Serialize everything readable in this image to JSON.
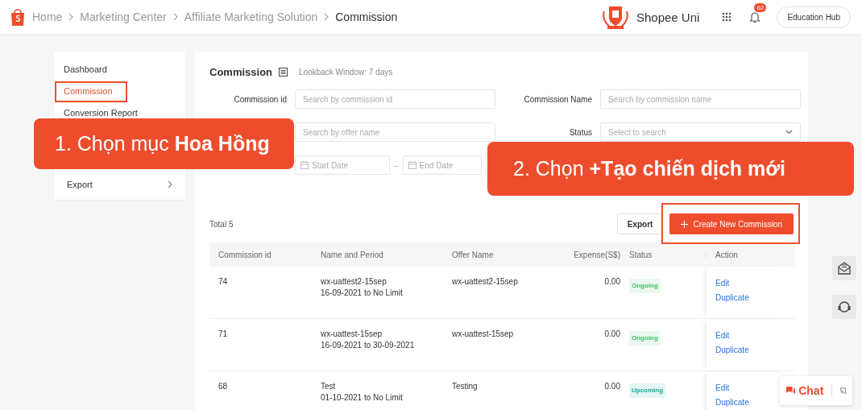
{
  "breadcrumb": [
    {
      "label": "Home",
      "current": false
    },
    {
      "label": "Marketing Center",
      "current": false
    },
    {
      "label": "Affiliate Marketing Solution",
      "current": false
    },
    {
      "label": "Commission",
      "current": true
    }
  ],
  "header": {
    "brand": "Shopee Uni",
    "notification_count": "62",
    "button": "Education Hub"
  },
  "sidebar": {
    "items": [
      {
        "label": "Dashboard",
        "selected": false
      },
      {
        "label": "Commission",
        "selected": true
      },
      {
        "label": "Conversion Report",
        "selected": false
      }
    ],
    "export": "Export"
  },
  "page": {
    "title": "Commission",
    "lookback": "Lookback Window: 7 days"
  },
  "filters": [
    {
      "kind": "text",
      "label": "Commission id",
      "placeholder": "Search by commission id"
    },
    {
      "kind": "text",
      "label": "Commission Name",
      "placeholder": "Search by commission name"
    },
    {
      "kind": "text",
      "placeholder": "Search by offer name"
    },
    {
      "kind": "select",
      "label": "Status",
      "placeholder": "Select to search"
    },
    {
      "kind": "daterange",
      "start_placeholder": "Start Date",
      "separator": "–",
      "end_placeholder": "End Date"
    }
  ],
  "total": "Total 5",
  "buttons": {
    "export": "Export",
    "create": "Create New Commission"
  },
  "table": {
    "columns": [
      "Commission id",
      "Name and Period",
      "Offer Name",
      "Expense(S$)",
      "Status",
      "Action"
    ],
    "rows": [
      {
        "id": "74",
        "name": "wx-uattest2-15sep",
        "period": "16-09-2021 to No Limit",
        "offer": "wx-uattest2-15sep",
        "expense": "0.00",
        "status": {
          "label": "Ongoing",
          "color": "#46c16b"
        },
        "actions": [
          "Edit",
          "Duplicate"
        ]
      },
      {
        "id": "71",
        "name": "wx-uattest-15sep",
        "period": "16-09-2021 to 30-09-2021",
        "offer": "wx-uattest-15sep",
        "expense": "0.00",
        "status": {
          "label": "Ongoing",
          "color": "#46c16b"
        },
        "actions": [
          "Edit",
          "Duplicate"
        ]
      },
      {
        "id": "68",
        "name": "Test",
        "period": "01-10-2021 to No Limit",
        "offer": "Testing",
        "expense": "0.00",
        "status": {
          "label": "Upcoming",
          "color": "#16a89a"
        },
        "actions": [
          "Edit",
          "Duplicate"
        ]
      }
    ]
  },
  "chat": {
    "label": "Chat"
  },
  "callouts": [
    {
      "text": "1. Chọn mục **Hoa Hồng**"
    },
    {
      "text": "2. Chọn **+Tạo chiến dịch mới**"
    }
  ]
}
